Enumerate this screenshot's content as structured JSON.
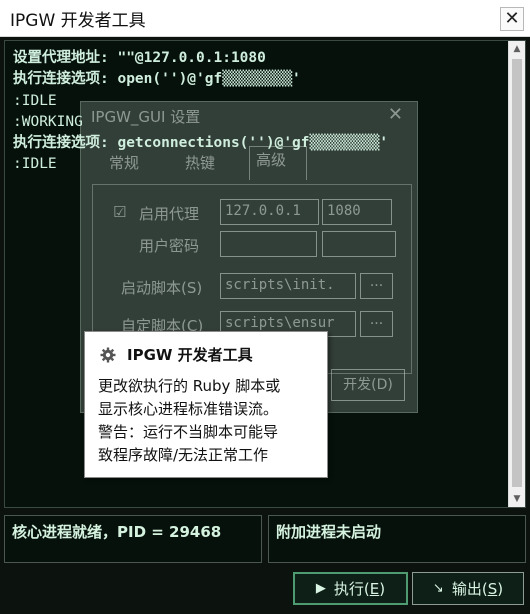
{
  "window": {
    "title": "IPGW 开发者工具",
    "close_glyph": "✕"
  },
  "console": {
    "lines": [
      {
        "text": "设置代理地址: \"\"@127.0.0.1:1080",
        "kind": "cmd"
      },
      {
        "text": "执行连接选项: open('')@'gf▒▒▒▒▒▒▒▒'",
        "kind": "cmd"
      },
      {
        "text": ":IDLE",
        "kind": "state"
      },
      {
        "text": ":WORKING",
        "kind": "state"
      },
      {
        "text": "执行连接选项: getconnections('')@'gf▒▒▒▒▒▒▒▒'",
        "kind": "cmd"
      },
      {
        "text": ":IDLE",
        "kind": "state"
      }
    ]
  },
  "background_dialog": {
    "title": "IPGW_GUI 设置",
    "close_glyph": "✕",
    "tabs": [
      "常规",
      "热键",
      "高级"
    ],
    "proxy_label": "启用代理",
    "proxy_host": "127.0.0.1",
    "proxy_port": "1080",
    "userpass_label": "用户密码",
    "startup_label": "启动脚本(S)",
    "startup_value": "scripts\\init.",
    "custom_label": "自定脚本(C)",
    "custom_value": "scripts\\ensur",
    "browse_label": "...",
    "dev_button": "开发(D)"
  },
  "tooltip": {
    "title": "IPGW 开发者工具",
    "lines": [
      "更改欲执行的 Ruby 脚本或",
      "显示核心进程标准错误流。",
      "警告：运行不当脚本可能导",
      "致程序故障/无法正常工作"
    ]
  },
  "status": {
    "core": "核心进程就绪，PID = 29468",
    "addon": "附加进程未启动"
  },
  "buttons": {
    "run_pre": "执行(",
    "run_key": "E",
    "run_post": ")",
    "out_pre": "输出(",
    "out_key": "S",
    "out_post": ")"
  },
  "colors": {
    "console_bg": "#06110c",
    "console_text": "#cfeedd",
    "accent": "#4e9b72"
  }
}
